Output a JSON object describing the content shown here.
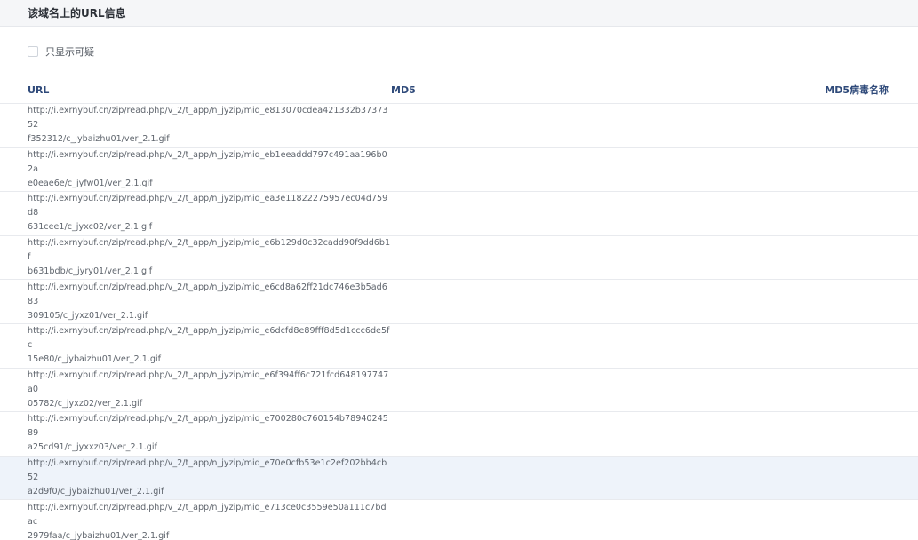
{
  "panel": {
    "title": "该域名上的URL信息"
  },
  "filter": {
    "label": "只显示可疑",
    "checked": false
  },
  "table": {
    "columns": {
      "url": "URL",
      "md5": "MD5",
      "md5_virus_name": "MD5病毒名称"
    },
    "rows": [
      {
        "url_line1": "http://i.exrnybuf.cn/zip/read.php/v_2/t_app/n_jyzip/mid_e813070cdea421332b3737352",
        "url_line2": "f352312/c_jybaizhu01/ver_2.1.gif",
        "md5": "",
        "virus": ""
      },
      {
        "url_line1": "http://i.exrnybuf.cn/zip/read.php/v_2/t_app/n_jyzip/mid_eb1eeaddd797c491aa196b02a",
        "url_line2": "e0eae6e/c_jyfw01/ver_2.1.gif",
        "md5": "",
        "virus": ""
      },
      {
        "url_line1": "http://i.exrnybuf.cn/zip/read.php/v_2/t_app/n_jyzip/mid_ea3e11822275957ec04d759d8",
        "url_line2": "631cee1/c_jyxc02/ver_2.1.gif",
        "md5": "",
        "virus": ""
      },
      {
        "url_line1": "http://i.exrnybuf.cn/zip/read.php/v_2/t_app/n_jyzip/mid_e6b129d0c32cadd90f9dd6b1f",
        "url_line2": "b631bdb/c_jyry01/ver_2.1.gif",
        "md5": "",
        "virus": ""
      },
      {
        "url_line1": "http://i.exrnybuf.cn/zip/read.php/v_2/t_app/n_jyzip/mid_e6cd8a62ff21dc746e3b5ad683",
        "url_line2": "309105/c_jyxz01/ver_2.1.gif",
        "md5": "",
        "virus": ""
      },
      {
        "url_line1": "http://i.exrnybuf.cn/zip/read.php/v_2/t_app/n_jyzip/mid_e6dcfd8e89fff8d5d1ccc6de5fc",
        "url_line2": "15e80/c_jybaizhu01/ver_2.1.gif",
        "md5": "",
        "virus": ""
      },
      {
        "url_line1": "http://i.exrnybuf.cn/zip/read.php/v_2/t_app/n_jyzip/mid_e6f394ff6c721fcd648197747a0",
        "url_line2": "05782/c_jyxz02/ver_2.1.gif",
        "md5": "",
        "virus": ""
      },
      {
        "url_line1": "http://i.exrnybuf.cn/zip/read.php/v_2/t_app/n_jyzip/mid_e700280c760154b7894024589",
        "url_line2": "a25cd91/c_jyxxz03/ver_2.1.gif",
        "md5": "",
        "virus": ""
      },
      {
        "url_line1": "http://i.exrnybuf.cn/zip/read.php/v_2/t_app/n_jyzip/mid_e70e0cfb53e1c2ef202bb4cb52",
        "url_line2": "a2d9f0/c_jybaizhu01/ver_2.1.gif",
        "md5": "",
        "virus": "",
        "highlighted": true
      },
      {
        "url_line1": "http://i.exrnybuf.cn/zip/read.php/v_2/t_app/n_jyzip/mid_e713ce0c3559e50a111c7bdac",
        "url_line2": "2979faa/c_jybaizhu01/ver_2.1.gif",
        "md5": "",
        "virus": ""
      }
    ]
  },
  "colors": {
    "header_bg": "#f5f6f8",
    "column_header_text": "#2f4a7a",
    "row_highlight_bg": "#eef3fa",
    "divider": "#e8eaee"
  }
}
